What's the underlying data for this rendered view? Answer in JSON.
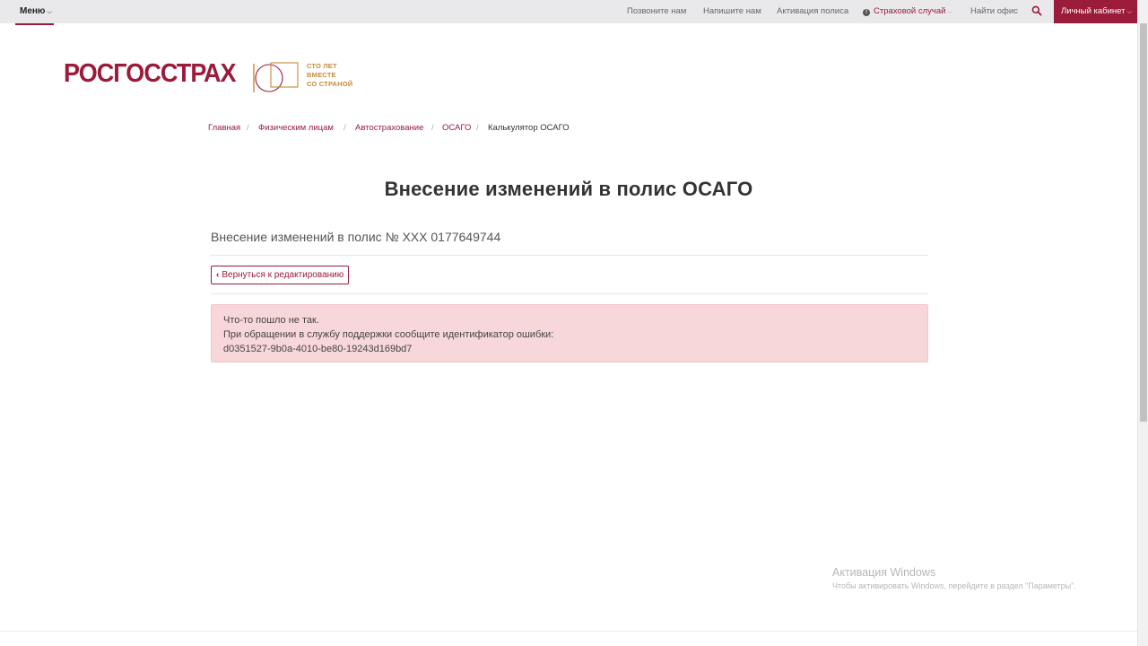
{
  "topbar": {
    "menu_label": "Меню",
    "links": [
      {
        "label": "Позвоните нам"
      },
      {
        "label": "Напишите нам"
      },
      {
        "label": "Активация полиса"
      },
      {
        "label": "Страховой случай"
      },
      {
        "label": "Найти офис"
      }
    ],
    "cabinet_label": "Личный кабинет"
  },
  "logo": {
    "brand": "РОСГОССТРАХ",
    "slogan_line1": "СТО ЛЕТ",
    "slogan_line2": "ВМЕСТЕ",
    "slogan_line3": "СО СТРАНОЙ"
  },
  "breadcrumbs": [
    {
      "label": "Главная"
    },
    {
      "label": "Физическим лицам"
    },
    {
      "label": "Автострахование"
    },
    {
      "label": "ОСАГО"
    },
    {
      "label": "Калькулятор ОСАГО"
    }
  ],
  "breadcrumb_separator": "/",
  "main": {
    "title": "Внесение изменений в полис ОСАГО",
    "policy_line": "Внесение изменений в полис № XXX 0177649744",
    "back_button_label": "Вернуться к редактированию",
    "error": {
      "line1": "Что-то пошло не так.",
      "line2": "При обращении в службу поддержки сообщите идентификатор ошибки:",
      "line3": "d0351527-9b0a-4010-be80-19243d169bd7"
    }
  },
  "watermark": {
    "title": "Активация Windows",
    "subtitle": "Чтобы активировать Windows, перейдите в раздел \"Параметры\"."
  },
  "colors": {
    "brand": "#9b1b3a",
    "alert_bg": "#f8d7da",
    "slogan": "#c58a3a"
  }
}
